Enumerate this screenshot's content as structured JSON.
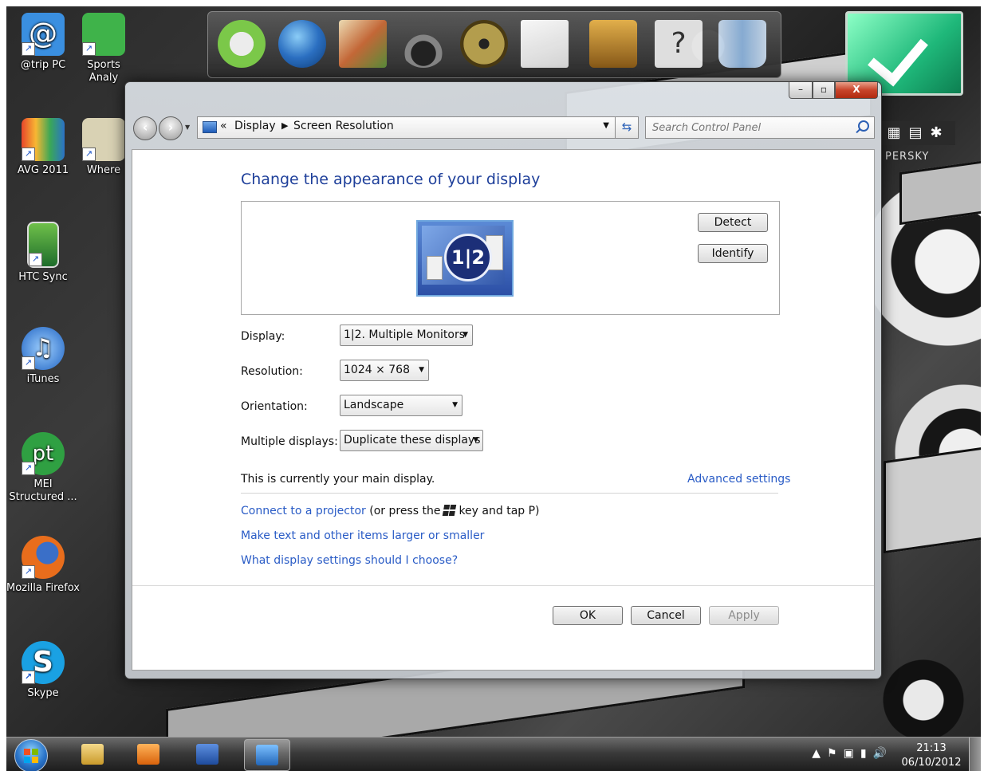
{
  "desktop": {
    "icons": [
      {
        "label": "@trip PC",
        "icon": "at-sign-icon",
        "color": "#3a8fe0"
      },
      {
        "label": "Sports Analy",
        "icon": "sports-icon",
        "color": "#3fb34a"
      },
      {
        "label": "AVG 2011",
        "icon": "avg-icon",
        "color": "#e8462b"
      },
      {
        "label": "Where",
        "icon": "map-icon",
        "color": "#d9d2b4"
      },
      {
        "label": "HTC Sync",
        "icon": "phone-icon",
        "color": "#6fc04a"
      },
      {
        "label": "iTunes",
        "icon": "music-note-icon",
        "color": "#3b8fe6"
      },
      {
        "label": "MEI Structured ...",
        "icon": "pt-icon",
        "color": "#2fa042"
      },
      {
        "label": "Mozilla Firefox",
        "icon": "firefox-icon",
        "color": "#e86d1c"
      },
      {
        "label": "Skype",
        "icon": "skype-icon",
        "color": "#1aa1e3"
      }
    ],
    "dock_items": [
      {
        "icon": "mail-icon",
        "color": "#7ecf4a"
      },
      {
        "icon": "globe-icon",
        "color": "#2b72c7"
      },
      {
        "icon": "photos-icon",
        "color": "#c96a38"
      },
      {
        "icon": "headphones-icon",
        "color": "#888888"
      },
      {
        "icon": "film-reel-icon",
        "color": "#b8a24e"
      },
      {
        "icon": "notes-icon",
        "color": "#d9d9d9"
      },
      {
        "icon": "padlock-icon",
        "color": "#c78a2e"
      },
      {
        "icon": "help-icon",
        "color": "#e6e6e6"
      },
      {
        "icon": "recycle-bin-icon",
        "color": "#8ab0d8"
      }
    ],
    "gadget_brand": "PERSKY"
  },
  "window": {
    "controls": {
      "minimize": "–",
      "maximize": "▫",
      "close": "X"
    },
    "nav": {
      "back": "‹",
      "forward": "›"
    },
    "address": {
      "chevron": "«",
      "crumbs": [
        "Display",
        "Screen Resolution"
      ],
      "separator": "▶"
    },
    "search": {
      "placeholder": "Search Control Panel"
    },
    "title": "Change the appearance of your display",
    "monitor_label": "1|2",
    "buttons": {
      "detect": "Detect",
      "identify": "Identify",
      "ok": "OK",
      "cancel": "Cancel",
      "apply": "Apply"
    },
    "settings": [
      {
        "label": "Display:",
        "value": "1|2. Multiple Monitors"
      },
      {
        "label": "Resolution:",
        "value": "1024 × 768"
      },
      {
        "label": "Orientation:",
        "value": "Landscape"
      },
      {
        "label": "Multiple displays:",
        "value": "Duplicate these displays"
      }
    ],
    "main_display_text": "This is currently your main display.",
    "advanced_link": "Advanced settings",
    "projector_link": "Connect to a projector",
    "projector_text_before": "(or press the",
    "projector_text_after": "key and tap P)",
    "text_size_link": "Make text and other items larger or smaller",
    "settings_help_link": "What display settings should I choose?"
  },
  "taskbar": {
    "apps": [
      {
        "icon": "file-explorer-icon",
        "color": "#e8c25a"
      },
      {
        "icon": "media-player-icon",
        "color": "#ef8b1f"
      },
      {
        "icon": "word-icon",
        "color": "#2b5fb4"
      },
      {
        "icon": "display-settings-icon",
        "color": "#3c8fd8"
      }
    ],
    "tray_icons": [
      "▲",
      "⚑",
      "▣",
      "▮",
      "🔊"
    ],
    "time": "21:13",
    "date": "06/10/2012"
  }
}
